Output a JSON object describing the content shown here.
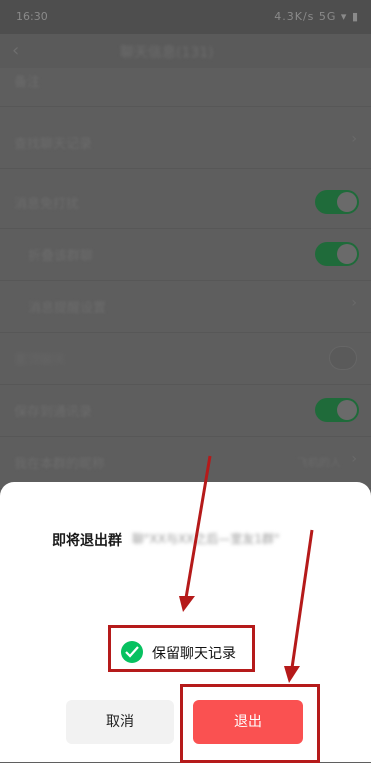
{
  "status_bar": {
    "time": "16:30",
    "right_text": "4.3K/s 5G ▾ ▮"
  },
  "nav": {
    "back_glyph": "‹",
    "title": "聊天信息(131)"
  },
  "settings_rows": [
    {
      "label": "备注",
      "type": "text"
    },
    {
      "label": "查找聊天记录",
      "type": "chevron"
    },
    {
      "label": "消息免打扰",
      "type": "toggle",
      "on": true
    },
    {
      "label": "折叠该群聊",
      "type": "toggle",
      "on": true
    },
    {
      "label": "消息提醒设置",
      "type": "chevron"
    },
    {
      "label": "置顶聊天",
      "type": "toggle",
      "on": false
    },
    {
      "label": "保存到通讯录",
      "type": "toggle",
      "on": true
    },
    {
      "label": "我在本群的昵称",
      "type": "value",
      "value": "飞机的人"
    }
  ],
  "dialog": {
    "message_bold": "即将退出群",
    "message_rest": "聊\"XX与XX之后—室友1群\"",
    "checkbox_label": "保留聊天记录",
    "checkbox_checked": true,
    "cancel_label": "取消",
    "confirm_label": "退出"
  },
  "colors": {
    "accent_green": "#07c160",
    "danger_red": "#fa5151",
    "annotation_red": "#b51a1a"
  }
}
